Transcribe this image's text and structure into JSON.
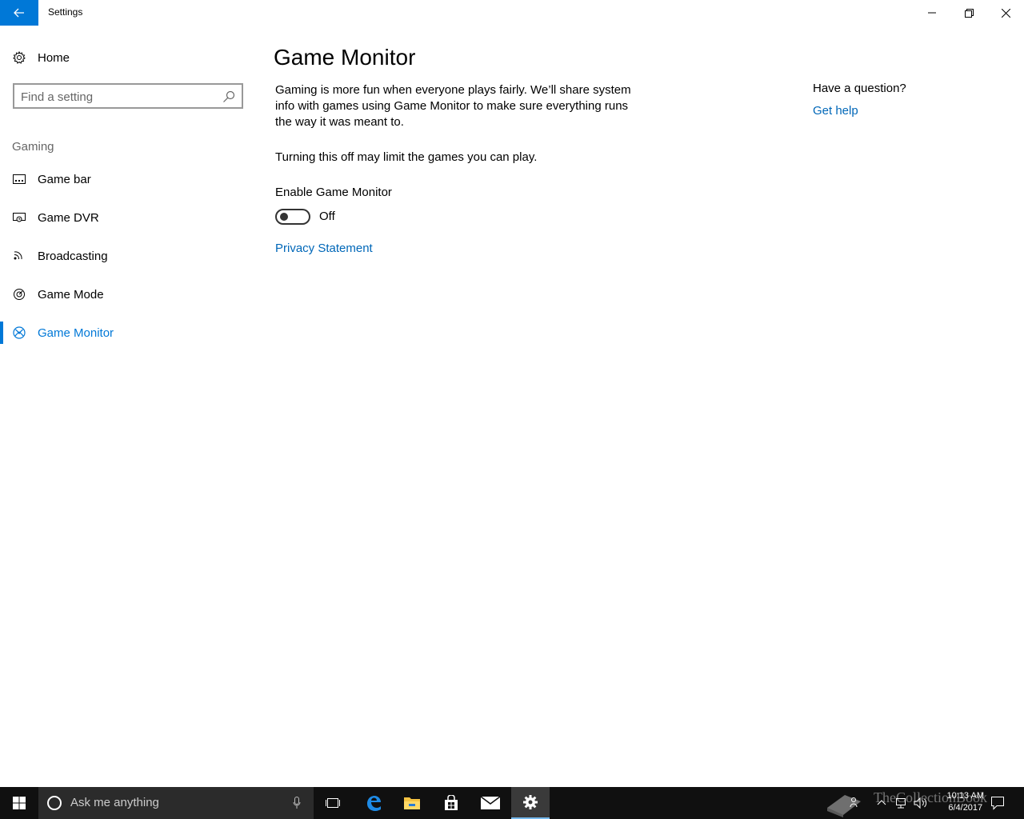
{
  "window": {
    "title": "Settings",
    "controls": [
      "minimize",
      "restore",
      "close"
    ]
  },
  "sidebar": {
    "home_label": "Home",
    "search_placeholder": "Find a setting",
    "section_label": "Gaming",
    "items": [
      {
        "label": "Game bar",
        "icon": "game-bar-icon",
        "active": false
      },
      {
        "label": "Game DVR",
        "icon": "game-dvr-icon",
        "active": false
      },
      {
        "label": "Broadcasting",
        "icon": "broadcasting-icon",
        "active": false
      },
      {
        "label": "Game Mode",
        "icon": "game-mode-icon",
        "active": false
      },
      {
        "label": "Game Monitor",
        "icon": "xbox-icon",
        "active": true
      }
    ]
  },
  "main": {
    "title": "Game Monitor",
    "description": "Gaming is more fun when everyone plays fairly. We’ll share system info with games using Game Monitor to make sure everything runs the way it was meant to.",
    "warning": "Turning this off may limit the games you can play.",
    "toggle_label": "Enable Game Monitor",
    "toggle_state": "Off",
    "toggle_on": false,
    "privacy_link": "Privacy Statement"
  },
  "help": {
    "question": "Have a question?",
    "link": "Get help"
  },
  "taskbar": {
    "search_placeholder": "Ask me anything",
    "time": "10:13 AM",
    "date": "6/4/2017",
    "watermark": "TheCollectionBook",
    "apps": [
      "task-view-icon",
      "edge-icon",
      "file-explorer-icon",
      "store-icon",
      "mail-icon",
      "settings-icon"
    ]
  },
  "colors": {
    "accent": "#0078d7",
    "link": "#0067b8",
    "taskbar": "#101010"
  }
}
